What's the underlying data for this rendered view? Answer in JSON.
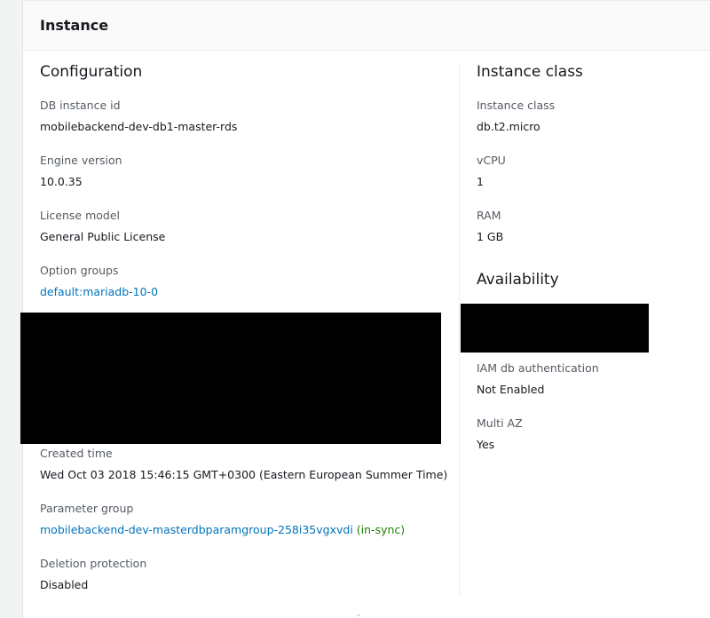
{
  "panel": {
    "title": "Instance"
  },
  "configuration": {
    "heading": "Configuration",
    "db_instance_id": {
      "label": "DB instance id",
      "value": "mobilebackend-dev-db1-master-rds"
    },
    "engine_version": {
      "label": "Engine version",
      "value": "10.0.35"
    },
    "license_model": {
      "label": "License model",
      "value": "General Public License"
    },
    "option_groups": {
      "label": "Option groups",
      "value": "default:mariadb-10-0"
    },
    "created_time": {
      "label": "Created time",
      "value": "Wed Oct 03 2018 15:46:15 GMT+0300 (Eastern European Summer Time)"
    },
    "parameter_group": {
      "label": "Parameter group",
      "value": "mobilebackend-dev-masterdbparamgroup-258i35vgxvdi",
      "status": "(in-sync)"
    },
    "deletion_protection": {
      "label": "Deletion protection",
      "value": "Disabled"
    }
  },
  "instance_class": {
    "heading": "Instance class",
    "instance_class": {
      "label": "Instance class",
      "value": "db.t2.micro"
    },
    "vcpu": {
      "label": "vCPU",
      "value": "1"
    },
    "ram": {
      "label": "RAM",
      "value": "1 GB"
    }
  },
  "availability": {
    "heading": "Availability",
    "iam_auth": {
      "label": "IAM db authentication",
      "value": "Not Enabled"
    },
    "multi_az": {
      "label": "Multi AZ",
      "value": "Yes"
    }
  },
  "colors": {
    "link": "#0073bb",
    "in_sync": "#1d8102",
    "label": "#545b64",
    "text": "#16191f"
  }
}
